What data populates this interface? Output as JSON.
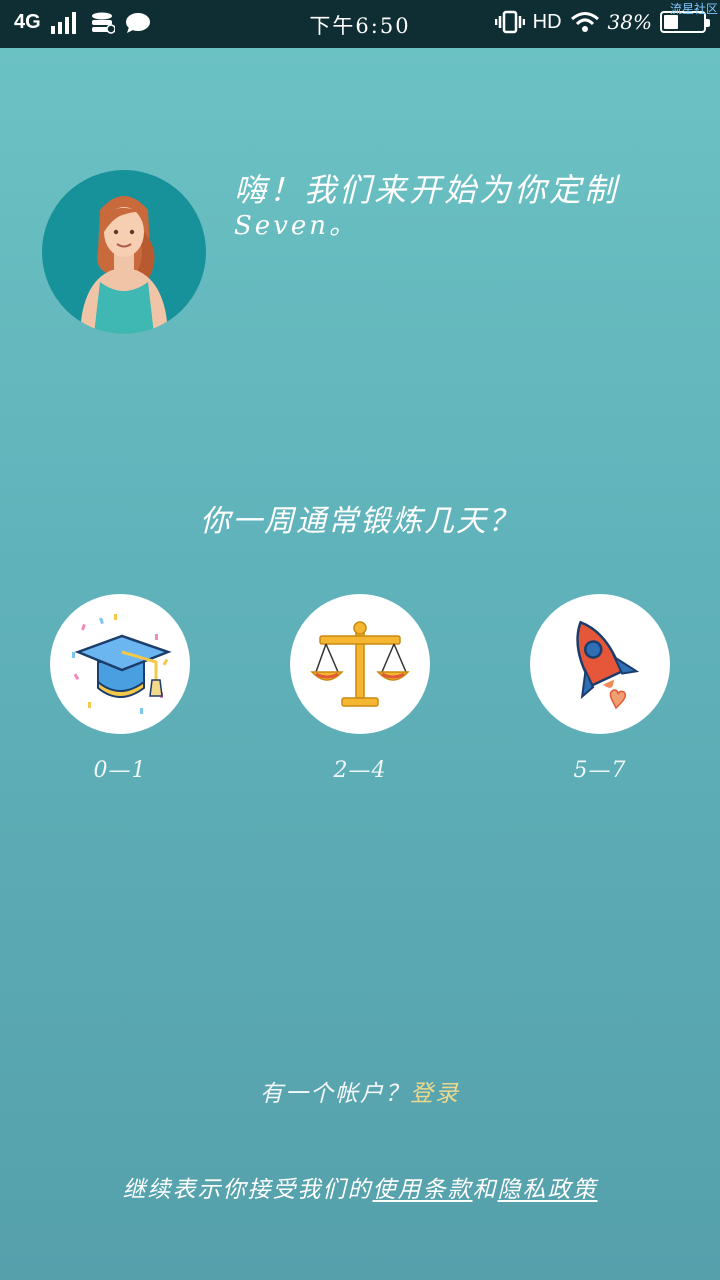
{
  "status_bar": {
    "network": "4G",
    "time": "下午6:50",
    "hd": "HD",
    "battery_text": "38%",
    "battery_level": 0.38,
    "watermark": "流星社区",
    "icons": [
      "signal-icon",
      "data-icon",
      "chat-icon",
      "vibrate-icon",
      "wifi-icon",
      "battery-icon"
    ]
  },
  "header": {
    "greeting": "嗨！我们来开始为你定制",
    "name": "Seven。"
  },
  "question": "你一周通常锻炼几天？",
  "options": [
    {
      "label": "0—1",
      "icon": "graduation-cap-icon"
    },
    {
      "label": "2—4",
      "icon": "balance-scale-icon"
    },
    {
      "label": "5—7",
      "icon": "rocket-icon"
    }
  ],
  "account": {
    "prompt": "有一个帐户？",
    "login_label": "登录"
  },
  "terms": {
    "prefix": "继续表示你接受我们的",
    "terms_link": "使用条款",
    "and": "和",
    "privacy_link": "隐私政策"
  },
  "colors": {
    "status_bg": "#0f2e33",
    "bg_top": "#6cc3c4",
    "bg_bottom": "#55a0ab",
    "login_accent": "#ecd98f"
  }
}
